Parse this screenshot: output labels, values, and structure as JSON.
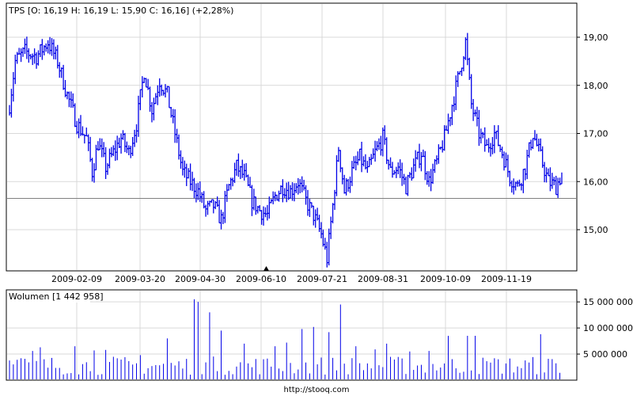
{
  "header": {
    "ticker": "TPS",
    "quote": "[O: 16,19  H: 16,19  L: 15,90  C: 16,16] (+2,28%)"
  },
  "volume_header": {
    "label": "Wolumen",
    "value": "[1 442 958]"
  },
  "footer": {
    "source": "http://stooq.com"
  },
  "colors": {
    "series": "#0000e8",
    "grid": "#d9d9d9",
    "frame": "#000000",
    "reference_line": "#808080"
  },
  "chart_data": [
    {
      "type": "line",
      "name": "price",
      "title": "TPS [O: 16,19  H: 16,19  L: 15,90  C: 16,16] (+2,28%)",
      "ylim": [
        14.3,
        19.25
      ],
      "yticks": [
        15.0,
        16.0,
        17.0,
        18.0,
        19.0
      ],
      "ytick_labels": [
        "15,00",
        "16,00",
        "17,00",
        "18,00",
        "19,00"
      ],
      "xtick_labels": [
        "2009-02-09",
        "2009-03-20",
        "2009-04-30",
        "2009-06-10",
        "2009-07-21",
        "2009-08-31",
        "2009-10-09",
        "2009-11-19"
      ],
      "reference_line": 15.65,
      "marker": "2009-06-10",
      "grid": true,
      "keypoints": [
        {
          "d": 0,
          "v": 17.6
        },
        {
          "d": 3,
          "v": 18.5
        },
        {
          "d": 8,
          "v": 18.7
        },
        {
          "d": 14,
          "v": 18.6
        },
        {
          "d": 20,
          "v": 18.9
        },
        {
          "d": 25,
          "v": 18.5
        },
        {
          "d": 30,
          "v": 17.8
        },
        {
          "d": 35,
          "v": 17.2
        },
        {
          "d": 40,
          "v": 16.9
        },
        {
          "d": 43,
          "v": 16.2
        },
        {
          "d": 46,
          "v": 16.8
        },
        {
          "d": 50,
          "v": 16.3
        },
        {
          "d": 54,
          "v": 16.6
        },
        {
          "d": 58,
          "v": 16.9
        },
        {
          "d": 62,
          "v": 16.6
        },
        {
          "d": 66,
          "v": 17.2
        },
        {
          "d": 70,
          "v": 18.3
        },
        {
          "d": 74,
          "v": 17.5
        },
        {
          "d": 78,
          "v": 18.1
        },
        {
          "d": 82,
          "v": 17.8
        },
        {
          "d": 86,
          "v": 17.0
        },
        {
          "d": 90,
          "v": 16.2
        },
        {
          "d": 94,
          "v": 16.0
        },
        {
          "d": 98,
          "v": 15.8
        },
        {
          "d": 102,
          "v": 15.4
        },
        {
          "d": 106,
          "v": 15.5
        },
        {
          "d": 110,
          "v": 15.2
        },
        {
          "d": 114,
          "v": 15.9
        },
        {
          "d": 118,
          "v": 16.3
        },
        {
          "d": 122,
          "v": 16.1
        },
        {
          "d": 126,
          "v": 15.6
        },
        {
          "d": 130,
          "v": 15.4
        },
        {
          "d": 134,
          "v": 15.3
        },
        {
          "d": 138,
          "v": 15.7
        },
        {
          "d": 142,
          "v": 15.9
        },
        {
          "d": 146,
          "v": 15.8
        },
        {
          "d": 150,
          "v": 16.0
        },
        {
          "d": 154,
          "v": 15.6
        },
        {
          "d": 158,
          "v": 15.3
        },
        {
          "d": 162,
          "v": 14.9
        },
        {
          "d": 165,
          "v": 14.4
        },
        {
          "d": 168,
          "v": 15.5
        },
        {
          "d": 171,
          "v": 16.7
        },
        {
          "d": 174,
          "v": 15.8
        },
        {
          "d": 178,
          "v": 16.2
        },
        {
          "d": 182,
          "v": 16.5
        },
        {
          "d": 186,
          "v": 16.2
        },
        {
          "d": 190,
          "v": 16.6
        },
        {
          "d": 194,
          "v": 16.9
        },
        {
          "d": 198,
          "v": 16.2
        },
        {
          "d": 202,
          "v": 16.3
        },
        {
          "d": 206,
          "v": 15.9
        },
        {
          "d": 210,
          "v": 16.3
        },
        {
          "d": 214,
          "v": 16.6
        },
        {
          "d": 218,
          "v": 16.0
        },
        {
          "d": 222,
          "v": 16.4
        },
        {
          "d": 226,
          "v": 16.9
        },
        {
          "d": 230,
          "v": 17.6
        },
        {
          "d": 234,
          "v": 18.3
        },
        {
          "d": 237,
          "v": 18.9
        },
        {
          "d": 240,
          "v": 17.6
        },
        {
          "d": 244,
          "v": 17.0
        },
        {
          "d": 248,
          "v": 16.7
        },
        {
          "d": 252,
          "v": 17.0
        },
        {
          "d": 256,
          "v": 16.6
        },
        {
          "d": 260,
          "v": 16.1
        },
        {
          "d": 264,
          "v": 15.9
        },
        {
          "d": 268,
          "v": 16.3
        },
        {
          "d": 272,
          "v": 17.0
        },
        {
          "d": 276,
          "v": 16.5
        },
        {
          "d": 280,
          "v": 16.0
        },
        {
          "d": 284,
          "v": 15.9
        },
        {
          "d": 287,
          "v": 16.16
        }
      ]
    },
    {
      "type": "bar",
      "name": "volume",
      "title": "Wolumen [1 442 958]",
      "ylim": [
        0,
        17000000
      ],
      "yticks": [
        5000000,
        10000000,
        15000000
      ],
      "ytick_labels": [
        "5 000 000",
        "10 000 000",
        "15 000 000"
      ],
      "grid": true,
      "spikes": [
        {
          "d": 7,
          "v": 4200000
        },
        {
          "d": 12,
          "v": 5600000
        },
        {
          "d": 17,
          "v": 6300000
        },
        {
          "d": 35,
          "v": 6500000
        },
        {
          "d": 45,
          "v": 5700000
        },
        {
          "d": 50,
          "v": 5800000
        },
        {
          "d": 69,
          "v": 4800000
        },
        {
          "d": 83,
          "v": 8000000
        },
        {
          "d": 97,
          "v": 15500000
        },
        {
          "d": 99,
          "v": 15000000
        },
        {
          "d": 104,
          "v": 13000000
        },
        {
          "d": 110,
          "v": 9500000
        },
        {
          "d": 123,
          "v": 7000000
        },
        {
          "d": 138,
          "v": 6500000
        },
        {
          "d": 145,
          "v": 7200000
        },
        {
          "d": 152,
          "v": 9800000
        },
        {
          "d": 158,
          "v": 10200000
        },
        {
          "d": 167,
          "v": 9200000
        },
        {
          "d": 173,
          "v": 14500000
        },
        {
          "d": 181,
          "v": 6500000
        },
        {
          "d": 190,
          "v": 5900000
        },
        {
          "d": 196,
          "v": 7000000
        },
        {
          "d": 209,
          "v": 5500000
        },
        {
          "d": 218,
          "v": 5600000
        },
        {
          "d": 228,
          "v": 8500000
        },
        {
          "d": 238,
          "v": 8500000
        },
        {
          "d": 243,
          "v": 8500000
        },
        {
          "d": 252,
          "v": 4200000
        },
        {
          "d": 277,
          "v": 8800000
        }
      ]
    }
  ]
}
